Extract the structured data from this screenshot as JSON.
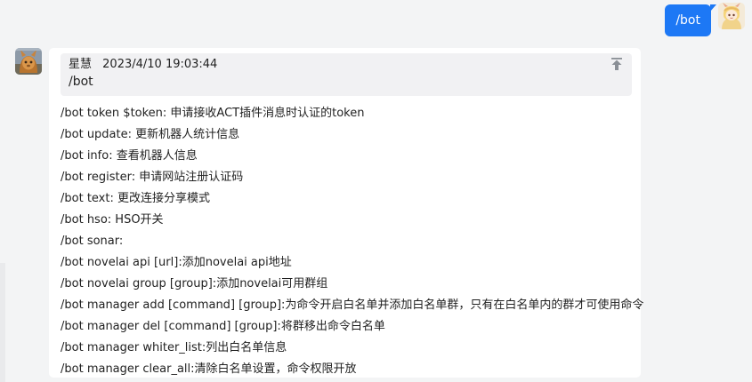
{
  "outgoing": {
    "text": "/bot"
  },
  "incoming": {
    "quote": {
      "sender": "星慧",
      "timestamp": "2023/4/10 19:03:44",
      "text": "/bot"
    },
    "lines": [
      "/bot token $token: 申请接收ACT插件消息时认证的token",
      "/bot update: 更新机器人统计信息",
      "/bot info: 查看机器人信息",
      "/bot register: 申请网站注册认证码",
      "/bot text: 更改连接分享模式",
      "/bot hso: HSO开关",
      "/bot sonar:",
      "/bot novelai api [url]:添加novelai api地址",
      "/bot novelai group [group]:添加novelai可用群组",
      "/bot manager add [command] [group]:为命令开启白名单并添加白名单群，只有在白名单内的群才可使用命令",
      "/bot manager del [command] [group]:将群移出命令白名单",
      "/bot manager whiter_list:列出白名单信息",
      "/bot manager clear_all:清除白名单设置，命令权限开放"
    ]
  },
  "icons": {
    "pin": "pin-top-icon"
  },
  "colors": {
    "accent": "#1d78f5",
    "background": "#f3f4f5",
    "bubble": "#ffffff",
    "quote_bg": "#f1f1f3"
  }
}
